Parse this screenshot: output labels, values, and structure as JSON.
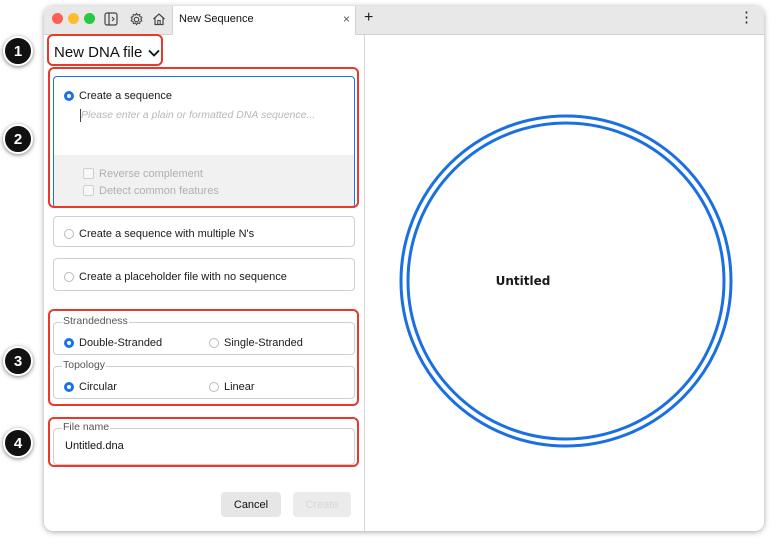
{
  "window": {
    "tab_title": "New Sequence",
    "tab_close": "×",
    "add_tab": "+",
    "more_menu": "⋮"
  },
  "toolbar_icons": [
    "sidebar-toggle-icon",
    "gear-icon",
    "home-icon"
  ],
  "left_panel": {
    "doc_type": "New DNA file",
    "create_sequence": {
      "label": "Create a sequence",
      "selected": true,
      "placeholder": "Please enter a plain or formatted DNA sequence...",
      "reverse_complement": "Reverse complement",
      "detect_features": "Detect common features"
    },
    "multiple_ns": "Create a sequence with multiple N's",
    "placeholder_file": "Create a placeholder file with no sequence",
    "strandedness": {
      "legend": "Strandedness",
      "double": "Double-Stranded",
      "single": "Single-Stranded",
      "selected": "Double-Stranded"
    },
    "topology": {
      "legend": "Topology",
      "circular": "Circular",
      "linear": "Linear",
      "selected": "Circular"
    },
    "file_name": {
      "legend": "File name",
      "value": "Untitled.dna"
    },
    "buttons": {
      "cancel": "Cancel",
      "create": "Create"
    }
  },
  "map": {
    "title": "Untitled"
  },
  "callouts": [
    "1",
    "2",
    "3",
    "4"
  ],
  "colors": {
    "accent": "#1a72e8",
    "callout": "#e8392b",
    "map_ring": "#1a6fe3"
  }
}
